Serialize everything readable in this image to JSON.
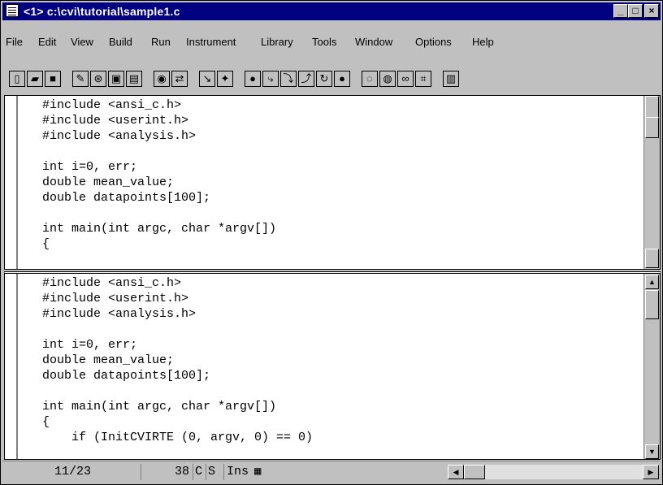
{
  "window": {
    "title": "<1> c:\\cvi\\tutorial\\sample1.c",
    "min_label": "_",
    "max_label": "□",
    "close_label": "×"
  },
  "menu": [
    "File",
    "Edit",
    "View",
    "Build",
    "Run",
    "Instrument",
    "Library",
    "Tools",
    "Window",
    "Options",
    "Help"
  ],
  "toolbar": {
    "icons": [
      "new-file-icon",
      "open-folder-icon",
      "save-disk-icon",
      "edit-icon",
      "run-icon",
      "build-icon",
      "panel-icon",
      "find-icon",
      "replace-icon",
      "goto-icon",
      "run-program-icon",
      "go-icon",
      "step-into-icon",
      "step-over-icon",
      "finish-icon",
      "continue-icon",
      "stop-icon",
      "breakpoint-icon",
      "tag-icon",
      "watch-icon",
      "variables-icon",
      "function-panel-icon"
    ]
  },
  "top_pane": {
    "lines": [
      "#include <ansi_c.h>",
      "#include <userint.h>",
      "#include <analysis.h>",
      "",
      "int i=0, err;",
      "double mean_value;",
      "double datapoints[100];",
      "",
      "int main(int argc, char *argv[])",
      "{"
    ]
  },
  "bottom_pane": {
    "lines": [
      "#include <ansi_c.h>",
      "#include <userint.h>",
      "#include <analysis.h>",
      "",
      "int i=0, err;",
      "double mean_value;",
      "double datapoints[100];",
      "",
      "int main(int argc, char *argv[])",
      "{",
      "    if (InitCVIRTE (0, argv, 0) == 0)"
    ]
  },
  "status": {
    "line_pos": "11/23",
    "column": "38",
    "flag_c": "C",
    "flag_s": "S",
    "mode": "Ins"
  }
}
